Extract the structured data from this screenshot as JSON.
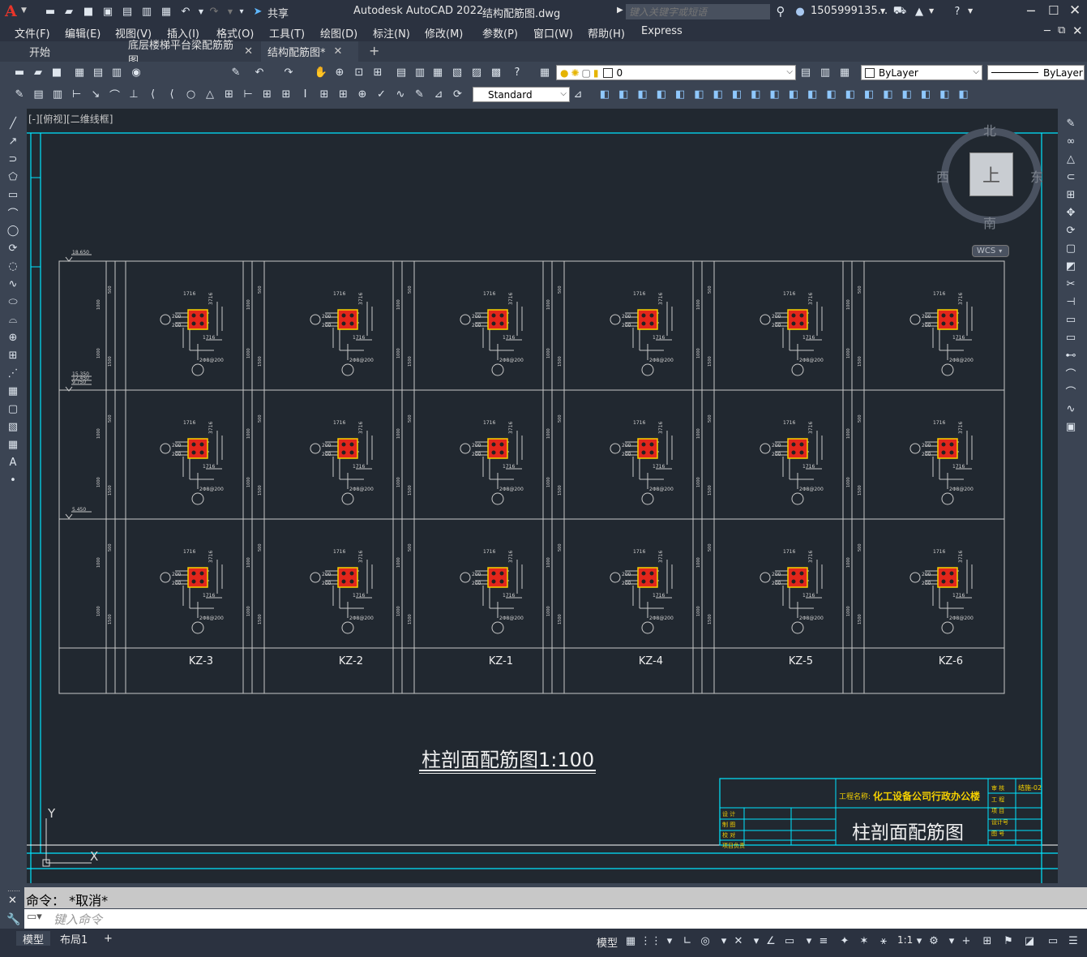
{
  "app": {
    "title": "Autodesk AutoCAD 2022",
    "filename": "结构配筋图.dwg",
    "logo": "A",
    "share_label": "共享",
    "search_placeholder": "键入关键字或短语",
    "user": "1505999135...",
    "colors": {
      "accent": "#00e5ff",
      "canvas": "#212830",
      "column": "#e3261b",
      "column_border": "#f5d000"
    }
  },
  "menus": [
    "文件(F)",
    "编辑(E)",
    "视图(V)",
    "插入(I)",
    "格式(O)",
    "工具(T)",
    "绘图(D)",
    "标注(N)",
    "修改(M)",
    "参数(P)",
    "窗口(W)",
    "帮助(H)",
    "Express"
  ],
  "tabs": [
    {
      "label": "开始",
      "closable": false,
      "active": false
    },
    {
      "label": "底层楼梯平台梁配筋筋图",
      "closable": true,
      "active": false
    },
    {
      "label": "结构配筋图*",
      "closable": true,
      "active": true
    }
  ],
  "toolbar": {
    "layer_value": "0",
    "color_value": "ByLayer",
    "linetype_value": "ByLayer",
    "textstyle_value": "Standard"
  },
  "viewport": {
    "label": "[-][俯视][二维线框]"
  },
  "viewcube": {
    "north": "北",
    "south": "南",
    "east": "东",
    "west": "西",
    "face": "上",
    "wcs": "WCS"
  },
  "drawing": {
    "columns": [
      "KZ-3",
      "KZ-2",
      "KZ-1",
      "KZ-4",
      "KZ-5",
      "KZ-6"
    ],
    "elevations": [
      "18.650",
      "15.350",
      "12.450",
      "9.750",
      "5.450"
    ],
    "row_labels": [
      "1716",
      "3716",
      "1716",
      "2Φ8@200"
    ],
    "title": "柱剖面配筋图",
    "scale": "1:100",
    "titleblock": {
      "project_label": "工程名称:",
      "project_name": "化工设备公司行政办公楼",
      "drawing_name": "柱剖面配筋图",
      "rows_left": [
        "设 计",
        "制 图",
        "校 对",
        "项目负责"
      ],
      "rows_right": [
        "审 核",
        "工 程",
        "项 目",
        "设计号",
        "图 号"
      ],
      "code": "结施-02"
    },
    "ucs_x": "X",
    "ucs_y": "Y"
  },
  "command": {
    "history": "命令：  *取消*",
    "placeholder": "键入命令"
  },
  "status": {
    "model_tab": "模型",
    "layout_tab": "布局1",
    "add_tab": "+",
    "scale": "1:1"
  }
}
